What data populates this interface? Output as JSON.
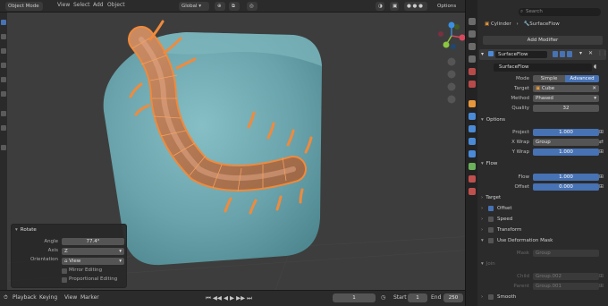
{
  "header": {
    "mode_label": "Object Mode",
    "menus": [
      "View",
      "Select",
      "Add",
      "Object"
    ],
    "transform_orientation": "Global",
    "options_label": "Options"
  },
  "operator_panel": {
    "title": "Rotate",
    "angle_label": "Angle",
    "angle_value": "77.4°",
    "axis_label": "Axis",
    "axis_value": "Z",
    "orientation_label": "Orientation",
    "orientation_value": "View",
    "mirror_label": "Mirror Editing",
    "proportional_label": "Proportional Editing"
  },
  "timeline": {
    "menus": [
      "Playback",
      "Keying",
      "View",
      "Marker"
    ],
    "current_frame": "1",
    "start_label": "Start",
    "start_value": "1",
    "end_label": "End",
    "end_value": "250"
  },
  "properties": {
    "search_placeholder": "Search",
    "breadcrumb": [
      "Cylinder",
      "SurfaceFlow"
    ],
    "add_modifier_label": "Add Modifier",
    "modifier_name": "SurfaceFlow",
    "modifier_name2": "SurfaceFlow",
    "mode_label": "Mode",
    "mode_options": [
      "Simple",
      "Advanced"
    ],
    "target_label": "Target",
    "target_value": "Cube",
    "method_label": "Method",
    "method_value": "Phased",
    "quality_label": "Quality",
    "quality_value": "32",
    "options_section": "Options",
    "project_label": "Project",
    "project_value": "1.000",
    "xwrap_label": "X Wrap",
    "xwrap_value": "Group",
    "ywrap_label": "Y Wrap",
    "ywrap_value": "1.000",
    "flow_section": "Flow",
    "flow_label": "Flow",
    "flow_value": "1.000",
    "offset_label": "Offset",
    "offset_value": "0.000",
    "sections": [
      "Target",
      "Offset",
      "Speed",
      "Transform",
      "Use Deformation Mask"
    ],
    "mask_label": "Mask",
    "mask_value": "Group",
    "join_section": "Join",
    "child_label": "Child",
    "child_value": "Group.002",
    "parent_label": "Parent",
    "parent_value": "Group.001",
    "smooth_section": "Smooth"
  },
  "colors": {
    "accent": "#4772b3",
    "cube": "#6aa3ab",
    "selection": "#f08a3c"
  }
}
